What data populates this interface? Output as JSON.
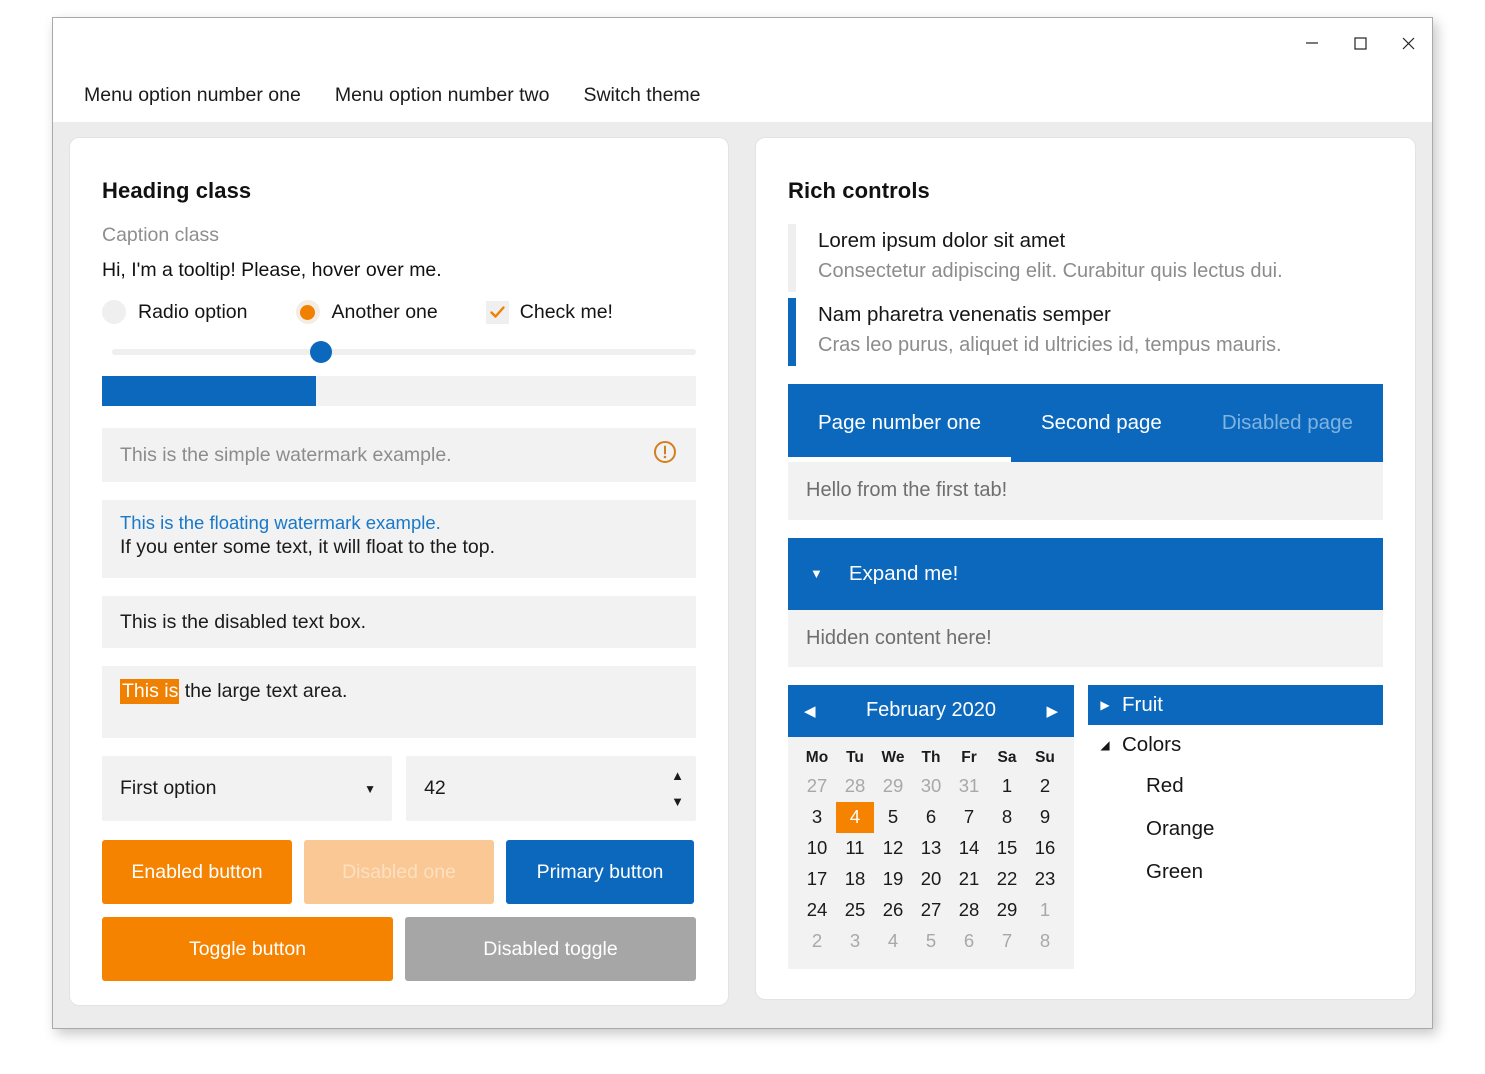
{
  "window": {
    "controls": {
      "minimize": "minimize-icon",
      "maximize": "maximize-icon",
      "close": "close-icon"
    },
    "menu": [
      "Menu option number one",
      "Menu option number two",
      "Switch theme"
    ]
  },
  "left": {
    "heading": "Heading class",
    "caption": "Caption class",
    "tooltip": "Hi, I'm a tooltip! Please, hover over me.",
    "radio1": "Radio option",
    "radio2": "Another one",
    "checkbox": "Check me!",
    "slider_value": 35,
    "progress_value": 36,
    "simple_watermark": "This is the simple watermark example.",
    "warn_icon": "warning-circle-icon",
    "float_label": "This is the floating watermark example.",
    "float_value": "If you enter some text, it will float to the top.",
    "disabled_box": "This is the disabled text box.",
    "textarea_selected": "This is",
    "textarea_rest": " the large text area.",
    "combo_value": "First option",
    "spinner_value": "42",
    "btn_enabled": "Enabled button",
    "btn_disabled": "Disabled one",
    "btn_primary": "Primary button",
    "btn_toggle": "Toggle button",
    "btn_toggle_disabled": "Disabled toggle"
  },
  "right": {
    "heading": "Rich controls",
    "items": [
      {
        "title": "Lorem ipsum dolor sit amet",
        "sub": "Consectetur adipiscing elit. Curabitur quis lectus dui."
      },
      {
        "title": "Nam pharetra venenatis semper",
        "sub": "Cras leo purus, aliquet id ultricies id, tempus mauris."
      }
    ],
    "tabs": [
      {
        "label": "Page number one",
        "state": "active"
      },
      {
        "label": "Second page",
        "state": "normal"
      },
      {
        "label": "Disabled page",
        "state": "disabled"
      }
    ],
    "tab_content": "Hello from the first tab!",
    "expander_label": "Expand me!",
    "expander_arrow": "chevron-down-icon",
    "expander_content": "Hidden content here!",
    "calendar": {
      "title": "February 2020",
      "prev": "chevron-left-icon",
      "next": "chevron-right-icon",
      "dow": [
        "Mo",
        "Tu",
        "We",
        "Th",
        "Fr",
        "Sa",
        "Su"
      ],
      "weeks": [
        [
          {
            "d": "27",
            "m": true
          },
          {
            "d": "28",
            "m": true
          },
          {
            "d": "29",
            "m": true
          },
          {
            "d": "30",
            "m": true
          },
          {
            "d": "31",
            "m": true
          },
          {
            "d": "1",
            "m": false
          },
          {
            "d": "2",
            "m": false
          }
        ],
        [
          {
            "d": "3",
            "m": false
          },
          {
            "d": "4",
            "m": false,
            "today": true
          },
          {
            "d": "5",
            "m": false
          },
          {
            "d": "6",
            "m": false
          },
          {
            "d": "7",
            "m": false
          },
          {
            "d": "8",
            "m": false
          },
          {
            "d": "9",
            "m": false
          }
        ],
        [
          {
            "d": "10",
            "m": false
          },
          {
            "d": "11",
            "m": false
          },
          {
            "d": "12",
            "m": false
          },
          {
            "d": "13",
            "m": false
          },
          {
            "d": "14",
            "m": false
          },
          {
            "d": "15",
            "m": false
          },
          {
            "d": "16",
            "m": false
          }
        ],
        [
          {
            "d": "17",
            "m": false
          },
          {
            "d": "18",
            "m": false
          },
          {
            "d": "19",
            "m": false
          },
          {
            "d": "20",
            "m": false
          },
          {
            "d": "21",
            "m": false
          },
          {
            "d": "22",
            "m": false
          },
          {
            "d": "23",
            "m": false
          }
        ],
        [
          {
            "d": "24",
            "m": false
          },
          {
            "d": "25",
            "m": false
          },
          {
            "d": "26",
            "m": false
          },
          {
            "d": "27",
            "m": false
          },
          {
            "d": "28",
            "m": false
          },
          {
            "d": "29",
            "m": false
          },
          {
            "d": "1",
            "m": true
          }
        ],
        [
          {
            "d": "2",
            "m": true
          },
          {
            "d": "3",
            "m": true
          },
          {
            "d": "4",
            "m": true
          },
          {
            "d": "5",
            "m": true
          },
          {
            "d": "6",
            "m": true
          },
          {
            "d": "7",
            "m": true
          },
          {
            "d": "8",
            "m": true
          }
        ]
      ]
    },
    "tree": {
      "nodes": [
        {
          "label": "Fruit",
          "arrow": "chevron-right-icon",
          "selected": true
        },
        {
          "label": "Colors",
          "arrow": "chevron-down-icon",
          "selected": false
        }
      ],
      "children": [
        "Red",
        "Orange",
        "Green"
      ]
    }
  },
  "colors": {
    "accent_blue": "#0b68bd",
    "accent_orange": "#f58300",
    "surface": "#f2f2f2",
    "window_bg": "#ececec"
  }
}
